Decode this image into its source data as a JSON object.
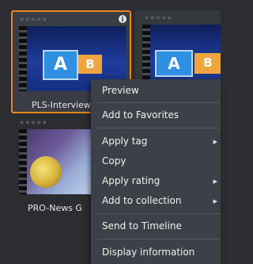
{
  "tiles": [
    {
      "label": "PLS-Interview",
      "stars": "★★★★★",
      "selected": true
    },
    {
      "label": "",
      "stars": "★★★★★"
    },
    {
      "label": "PRO-News G",
      "stars": "★★★★★"
    }
  ],
  "thumb_letters": {
    "a": "A",
    "b": "B"
  },
  "info_glyph": "i",
  "context_menu": {
    "items": [
      {
        "label": "Preview",
        "has_submenu": false
      },
      {
        "label": "Add to Favorites",
        "has_submenu": false
      },
      {
        "label": "Apply tag",
        "has_submenu": true
      },
      {
        "label": "Copy",
        "has_submenu": false
      },
      {
        "label": "Apply rating",
        "has_submenu": true
      },
      {
        "label": "Add to collection",
        "has_submenu": true
      },
      {
        "label": "Send to Timeline",
        "has_submenu": false
      },
      {
        "label": "Display information",
        "has_submenu": false
      }
    ],
    "submenu_arrow": "▶"
  },
  "colors": {
    "selection_border": "#e8861d",
    "menu_bg": "#3d4046",
    "background": "#2b2d31"
  }
}
